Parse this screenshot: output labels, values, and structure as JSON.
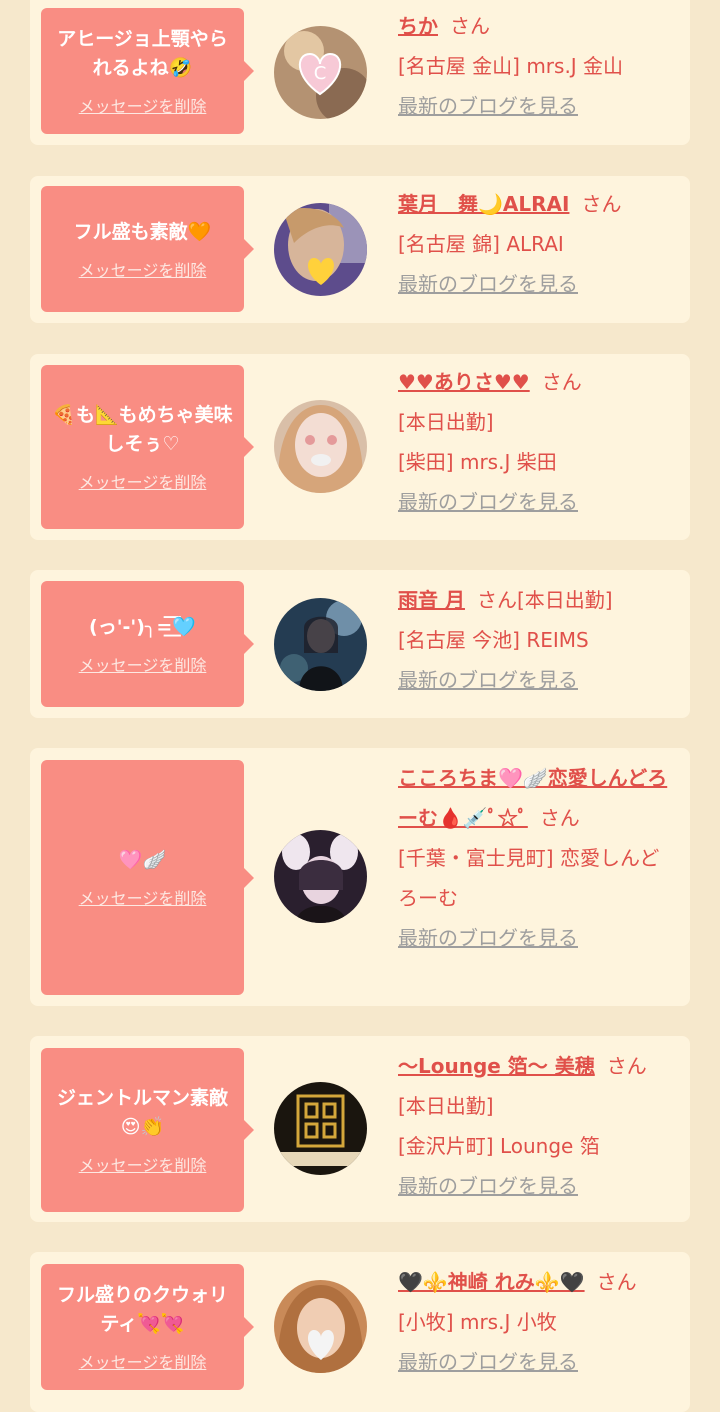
{
  "cards": [
    {
      "message": "アヒージョ上顎やられるよね🤣",
      "delete_label": "メッセージを削除",
      "name": "ちか",
      "honorific": "さん",
      "lines": [
        "[名古屋 金山] mrs.J 金山"
      ],
      "blog_label": "最新のブログを見る"
    },
    {
      "message": "フル盛も素敵🧡",
      "delete_label": "メッセージを削除",
      "name": "葉月　舞🌙ALRAI",
      "honorific": "さん",
      "lines": [
        "[名古屋 錦] ALRAI"
      ],
      "blog_label": "最新のブログを見る"
    },
    {
      "message": "🍕も📐もめちゃ美味しそぅ♡",
      "delete_label": "メッセージを削除",
      "name": "♥♥ありさ♥♥",
      "honorific": "さん",
      "lines": [
        "[本日出勤]",
        "[柴田] mrs.J 柴田"
      ],
      "blog_label": "最新のブログを見る"
    },
    {
      "message": "(っ'-')╮=͟͟͞͞🩵",
      "delete_label": "メッセージを削除",
      "name": "雨音 月",
      "honorific": "さん[本日出勤]",
      "lines": [
        "[名古屋 今池] REIMS"
      ],
      "blog_label": "最新のブログを見る"
    },
    {
      "message": "🩷🪽",
      "delete_label": "メッセージを削除",
      "name": "こころちま🩷🪽恋愛しんどろーむ🩸💉ﾟ☆ﾟ",
      "honorific": "さん",
      "lines": [
        "[千葉・富士見町] 恋愛しんどろーむ"
      ],
      "blog_label": "最新のブログを見る"
    },
    {
      "message": "ジェントルマン素敵😍👏",
      "delete_label": "メッセージを削除",
      "name": "〜Lounge 箔〜 美穂",
      "honorific": "さん",
      "lines": [
        "[本日出勤]",
        "[金沢片町] Lounge 箔"
      ],
      "blog_label": "最新のブログを見る"
    },
    {
      "message": "フル盛りのクウォリティ💘💘",
      "delete_label": "メッセージを削除",
      "name": "🖤⚜️神崎 れみ⚜️🖤",
      "honorific": "さん",
      "lines": [
        "[小牧] mrs.J 小牧"
      ],
      "blog_label": "最新のブログを見る"
    }
  ],
  "avatars": [
    "avatar-heart-c",
    "avatar-yellow-heart",
    "avatar-face",
    "avatar-girl-moon",
    "avatar-bunny-ears",
    "avatar-lounge-logo",
    "avatar-white-heart"
  ]
}
